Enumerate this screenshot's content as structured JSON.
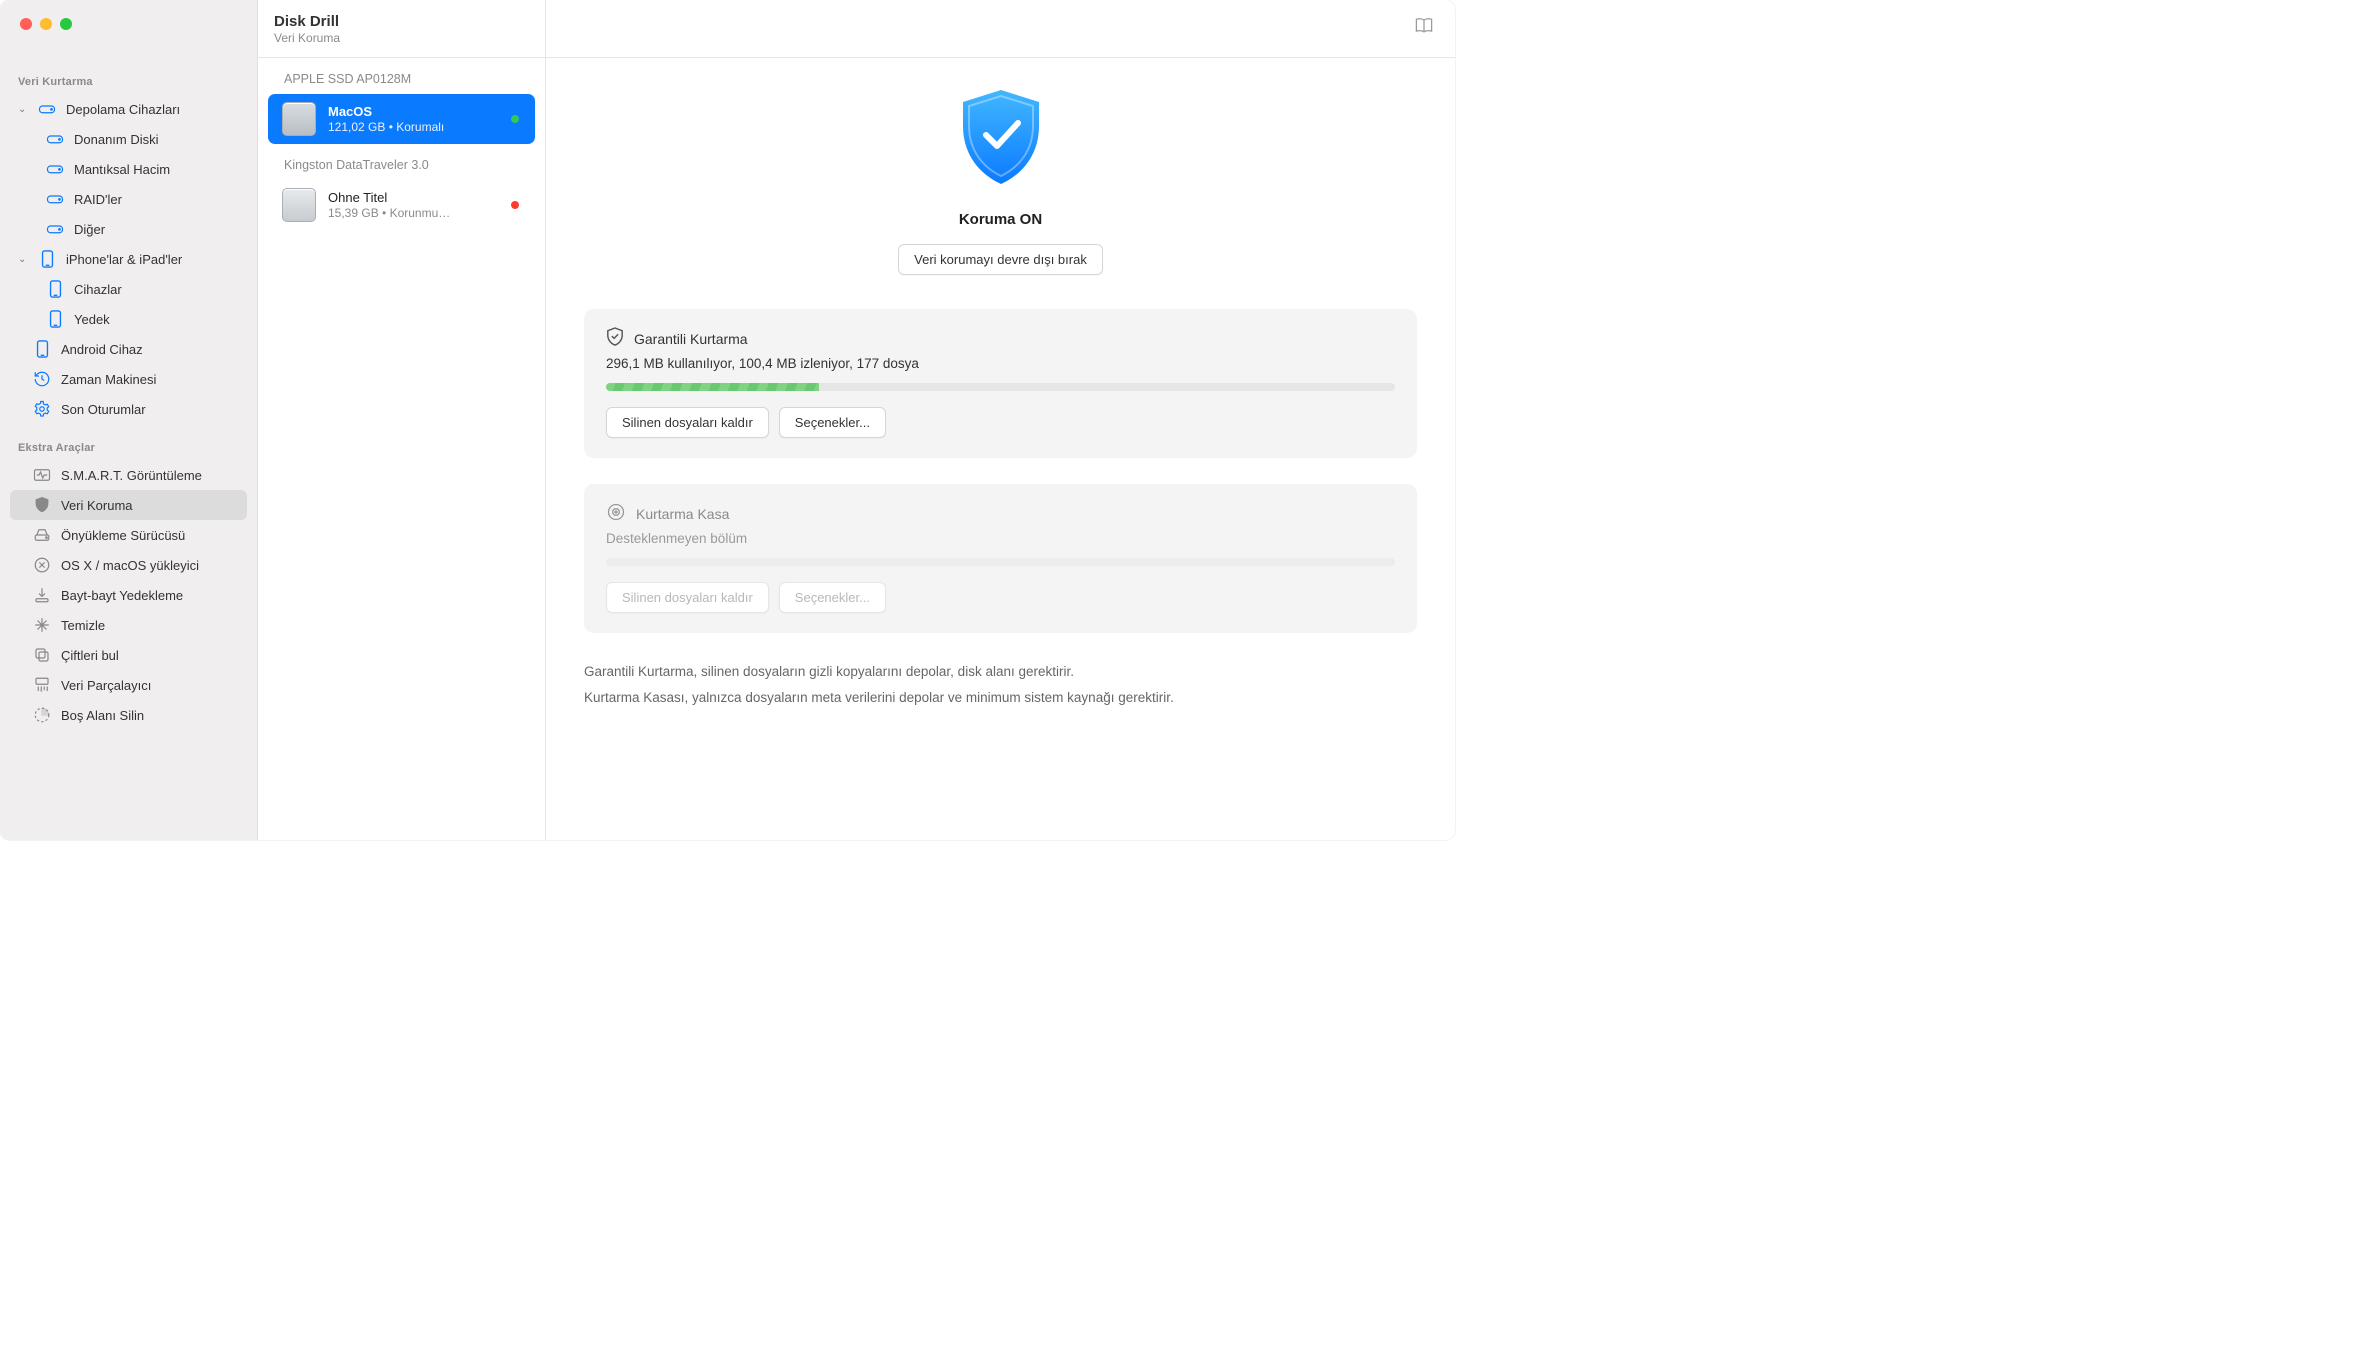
{
  "header": {
    "title": "Disk Drill",
    "subtitle": "Veri Koruma"
  },
  "sidebar": {
    "section1_heading": "Veri Kurtarma",
    "storage": {
      "label": "Depolama Cihazları",
      "children": {
        "hw": "Donanım Diski",
        "logical": "Mantıksal Hacim",
        "raid": "RAID'ler",
        "other": "Diğer"
      }
    },
    "ios": {
      "label": "iPhone'lar & iPad'ler",
      "devices": "Cihazlar",
      "backup": "Yedek"
    },
    "android": "Android Cihaz",
    "tm": "Zaman Makinesi",
    "sessions": "Son Oturumlar",
    "section2_heading": "Ekstra Araçlar",
    "smart": "S.M.A.R.T. Görüntüleme",
    "protect": "Veri Koruma",
    "bootdrive": "Önyükleme Sürücüsü",
    "installer": "OS X / macOS yükleyici",
    "bytebackup": "Bayt-bayt Yedekleme",
    "clean": "Temizle",
    "dup": "Çiftleri bul",
    "shred": "Veri Parçalayıcı",
    "erase": "Boş Alanı Silin"
  },
  "devices": {
    "group1_head": "APPLE SSD AP0128M",
    "group1_items": [
      {
        "title": "MacOS",
        "sub": "121,02 GB • Korumalı",
        "status": "green",
        "selected": true
      }
    ],
    "group2_head": "Kingston DataTraveler 3.0",
    "group2_items": [
      {
        "title": "Ohne Titel",
        "sub": "15,39 GB • Korunmu…",
        "status": "red",
        "selected": false
      }
    ]
  },
  "main": {
    "shield_status": "Koruma ON",
    "disable_btn": "Veri korumayı devre dışı bırak",
    "card1": {
      "title": "Garantili Kurtarma",
      "stats": "296,1 MB kullanılıyor, 100,4 MB izleniyor, 177 dosya",
      "progress_pct": 27,
      "btn1": "Silinen dosyaları kaldır",
      "btn2": "Seçenekler..."
    },
    "card2": {
      "title": "Kurtarma Kasa",
      "stats": "Desteklenmeyen bölüm",
      "btn1": "Silinen dosyaları kaldır",
      "btn2": "Seçenekler..."
    },
    "info1": "Garantili Kurtarma, silinen dosyaların gizli kopyalarını depolar, disk alanı gerektirir.",
    "info2": "Kurtarma Kasası, yalnızca dosyaların meta verilerini depolar ve minimum sistem kaynağı gerektirir."
  }
}
